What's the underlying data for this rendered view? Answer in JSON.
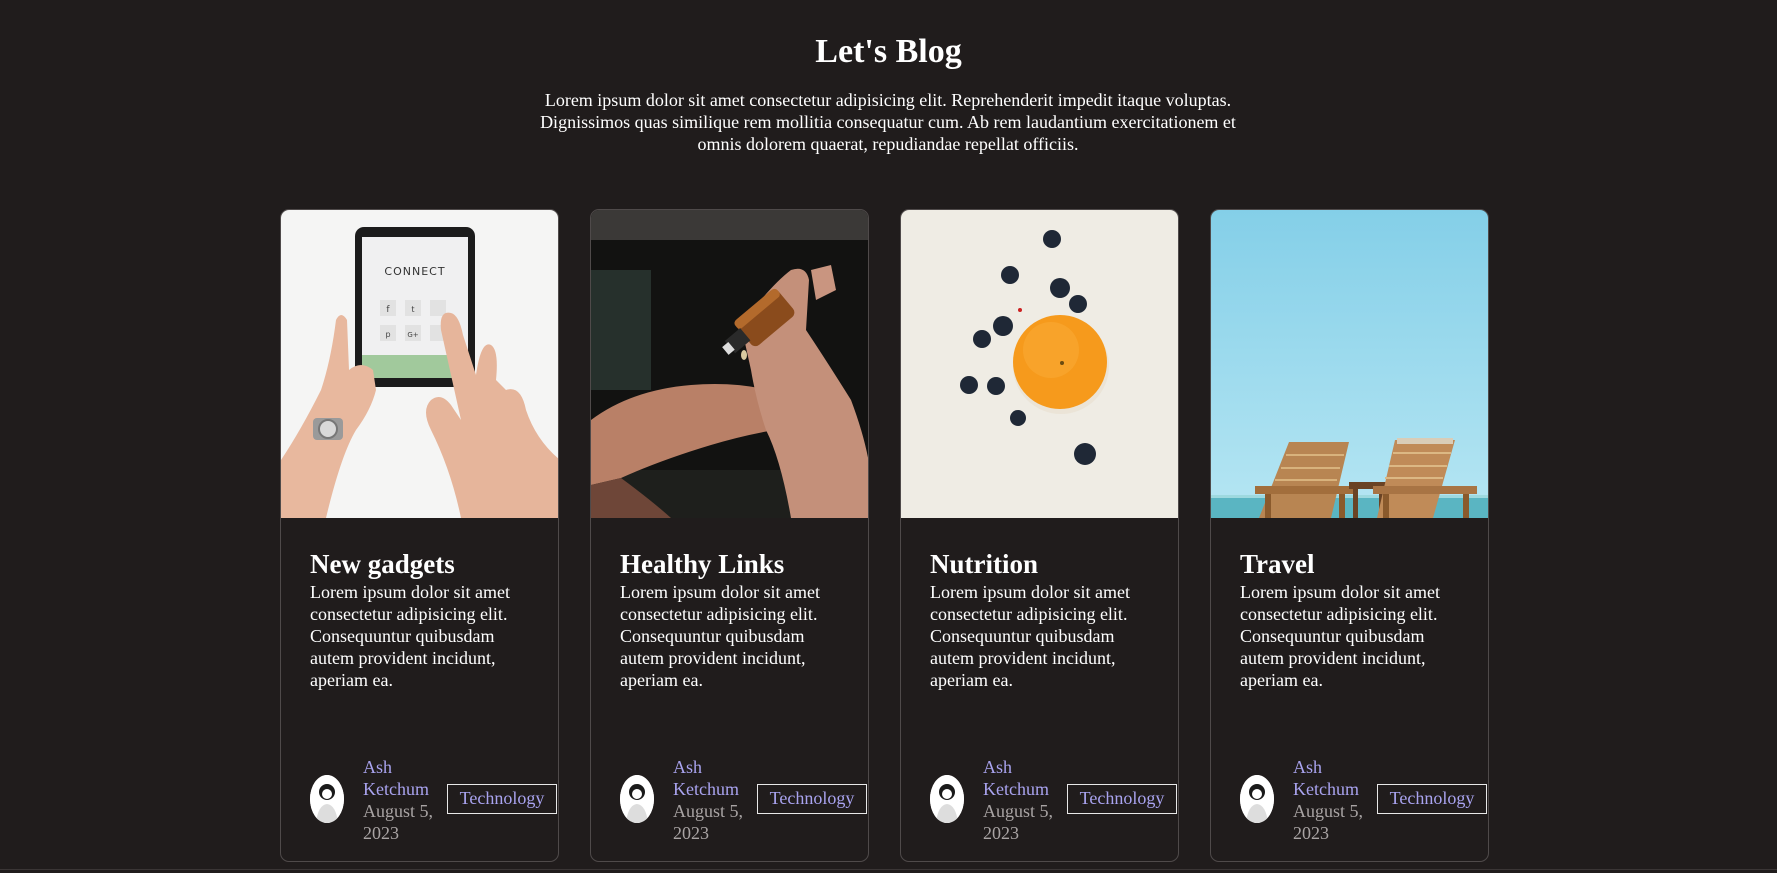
{
  "header": {
    "title": "Let's Blog",
    "intro": "Lorem ipsum dolor sit amet consectetur adipisicing elit. Reprehenderit impedit itaque voluptas. Dignissimos quas similique rem mollitia consequatur cum. Ab rem laudantium exercitationem et omnis dolorem quaerat, repudiandae repellat officiis."
  },
  "cards": [
    {
      "title": "New gadgets",
      "text": "Lorem ipsum dolor sit amet consectetur adipisicing elit. Consequuntur quibusdam autem provident incidunt, aperiam ea.",
      "image_text": "CONNECT",
      "author": "Ash Ketchum",
      "date": "August 5, 2023",
      "tag": "Technology"
    },
    {
      "title": "Healthy Links",
      "text": "Lorem ipsum dolor sit amet consectetur adipisicing elit. Consequuntur quibusdam autem provident incidunt, aperiam ea.",
      "author": "Ash Ketchum",
      "date": "August 5, 2023",
      "tag": "Technology"
    },
    {
      "title": "Nutrition",
      "text": "Lorem ipsum dolor sit amet consectetur adipisicing elit. Consequuntur quibusdam autem provident incidunt, aperiam ea.",
      "author": "Ash Ketchum",
      "date": "August 5, 2023",
      "tag": "Technology"
    },
    {
      "title": "Travel",
      "text": "Lorem ipsum dolor sit amet consectetur adipisicing elit. Consequuntur quibusdam autem provident incidunt, aperiam ea.",
      "author": "Ash Ketchum",
      "date": "August 5, 2023",
      "tag": "Technology"
    }
  ],
  "colors": {
    "background": "#201c1c",
    "author_link": "#a9a3ef",
    "date_text": "#a9a4a4",
    "tag_border": "#e8e8e8"
  }
}
